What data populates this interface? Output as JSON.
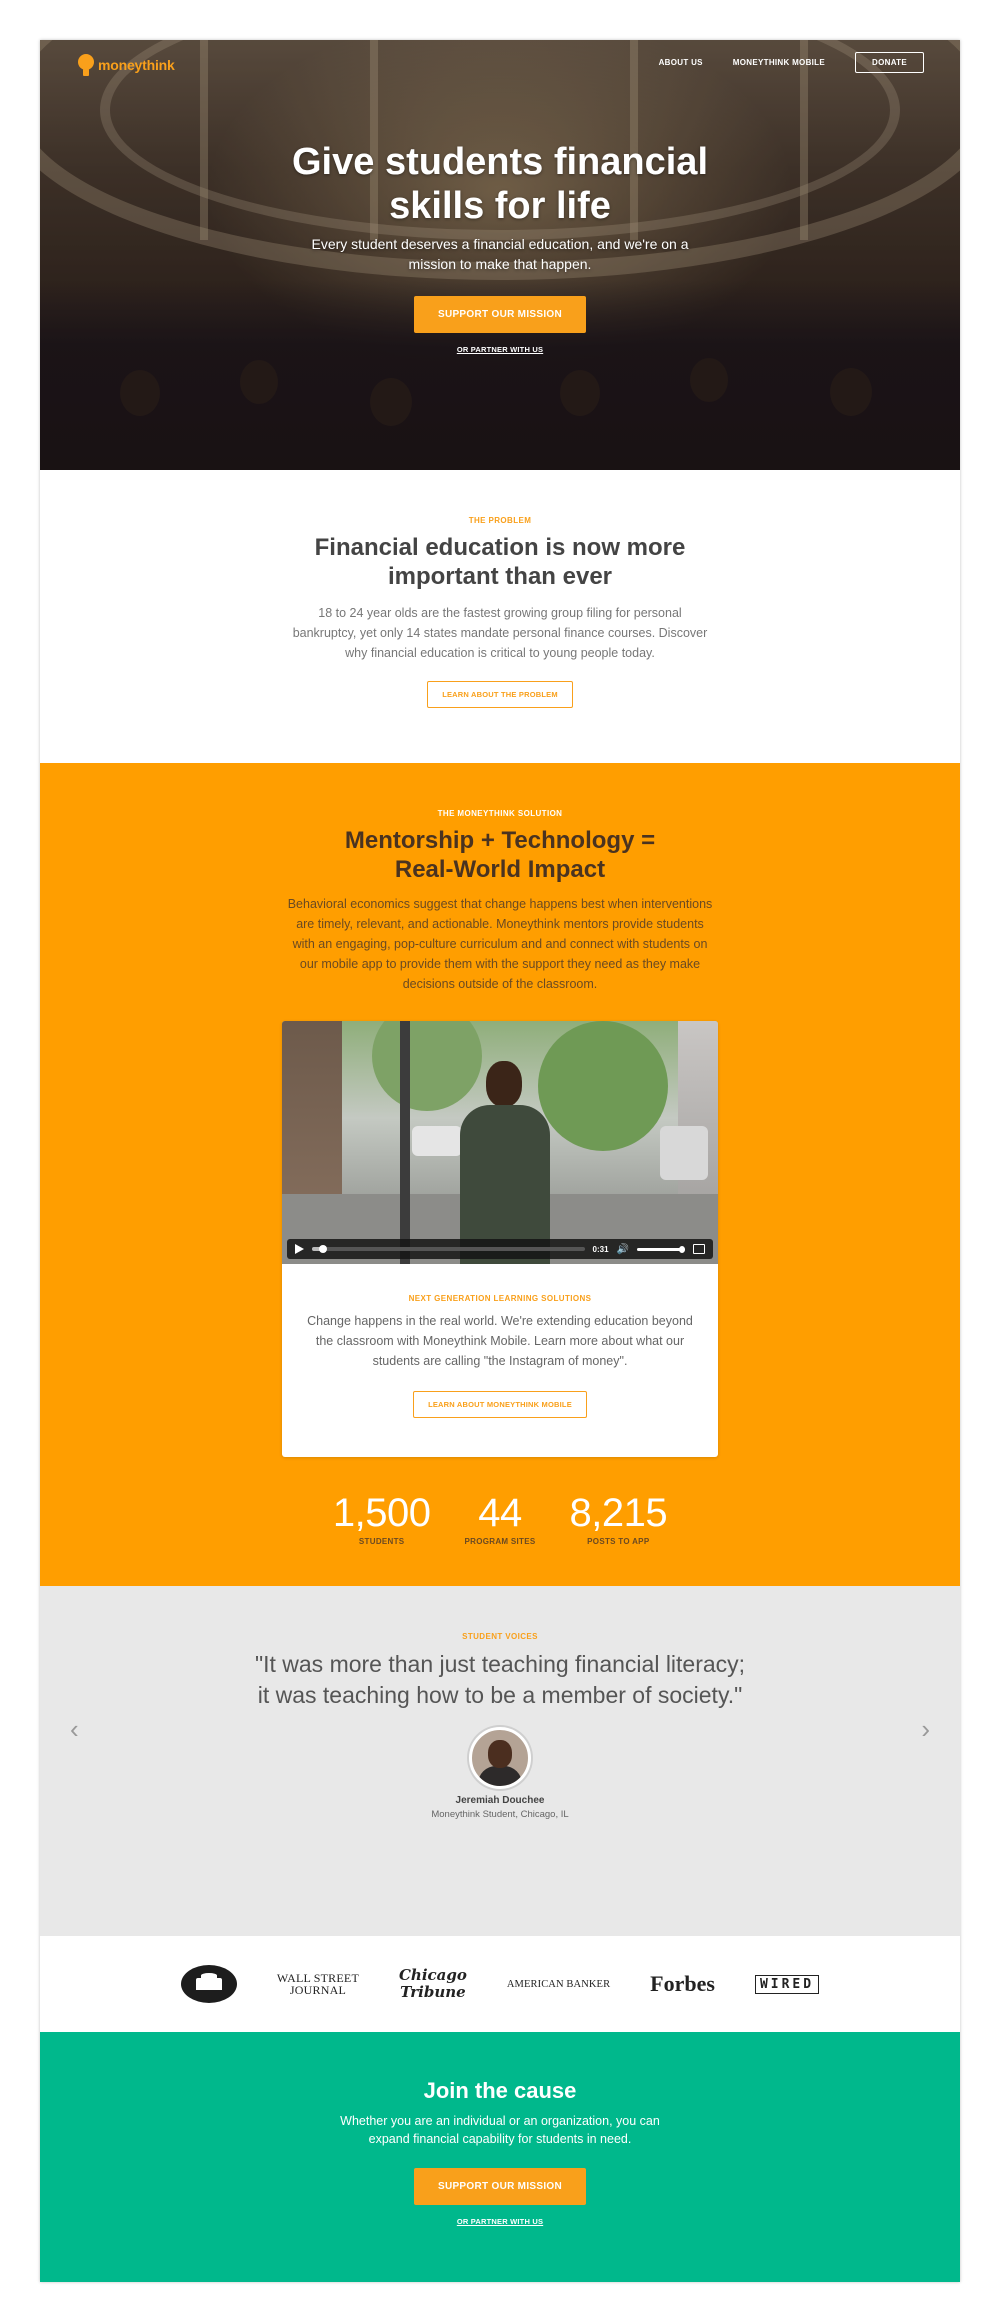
{
  "brand": {
    "name": "moneythink",
    "accent": "#f9a01b",
    "orange_bg": "#ff9e00",
    "green_bg": "#00b88c"
  },
  "nav": {
    "items": [
      "ABOUT US",
      "MONEYTHINK MOBILE"
    ],
    "donate": "DONATE"
  },
  "hero": {
    "title": "Give students financial skills for life",
    "subtitle": "Every student deserves a financial education, and we're on a mission to make that happen.",
    "cta": "SUPPORT OUR MISSION",
    "secondary_link": "OR PARTNER WITH US"
  },
  "problem": {
    "eyebrow": "THE PROBLEM",
    "title": "Financial education is now more important than ever",
    "body": "18 to 24 year olds are the fastest growing group filing for personal bankruptcy, yet only 14 states mandate personal finance courses. Discover why financial education is critical to young people today.",
    "button": "LEARN ABOUT THE PROBLEM"
  },
  "solution": {
    "eyebrow": "THE MONEYTHINK SOLUTION",
    "title": "Mentorship + Technology = Real-World Impact",
    "body": "Behavioral economics suggest that change happens best when interventions are timely, relevant, and actionable. Moneythink mentors provide students with an engaging, pop-culture curriculum and and connect with students on our mobile app to provide them with the support they need as they make decisions outside of the classroom.",
    "video": {
      "time": "0:31",
      "progress": 0.04
    },
    "card": {
      "eyebrow": "NEXT GENERATION LEARNING SOLUTIONS",
      "body": "Change happens in the real world. We're extending education beyond the classroom with Moneythink Mobile. Learn more about what our students are calling \"the Instagram of money\".",
      "button": "LEARN ABOUT MONEYTHINK MOBILE"
    },
    "stats": [
      {
        "value": "1,500",
        "label": "STUDENTS"
      },
      {
        "value": "44",
        "label": "PROGRAM SITES"
      },
      {
        "value": "8,215",
        "label": "POSTS TO APP"
      }
    ]
  },
  "voices": {
    "eyebrow": "STUDENT VOICES",
    "quote": "\"It was more than just teaching financial literacy; it was teaching how to be a member of society.\"",
    "name": "Jeremiah Douchee",
    "role": "Moneythink Student, Chicago, IL"
  },
  "press": {
    "wsj": [
      "WALL STREET",
      "JOURNAL"
    ],
    "chicago": [
      "Chicago",
      "Tribune"
    ],
    "american_banker": "AMERICAN BANKER",
    "forbes": "Forbes",
    "wired": "WIRED"
  },
  "join": {
    "title": "Join the cause",
    "body": "Whether you are an individual or an organization, you can expand financial capability for students in need.",
    "cta": "SUPPORT OUR MISSION",
    "secondary_link": "OR PARTNER WITH US"
  }
}
